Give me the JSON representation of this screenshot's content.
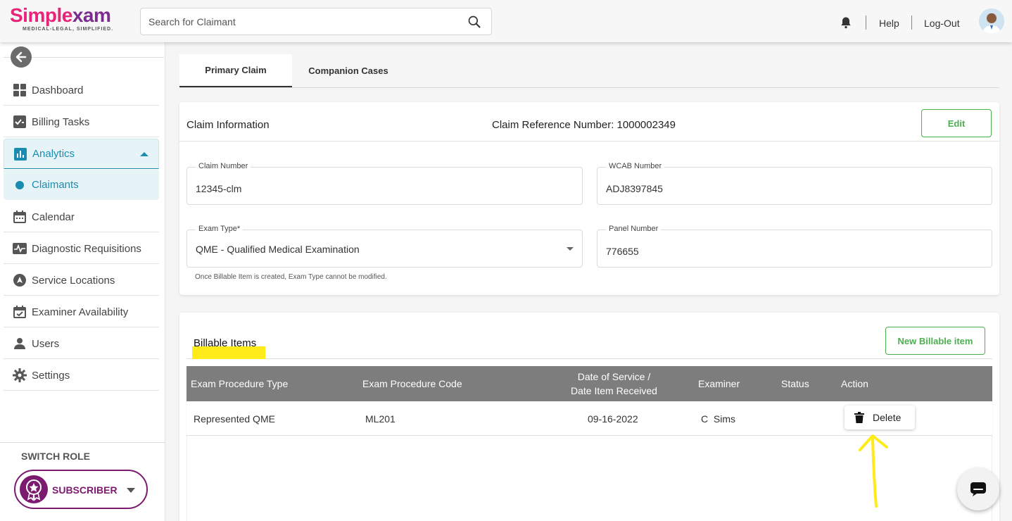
{
  "header": {
    "logo_text_1": "Simple",
    "logo_text_2": "xam",
    "logo_tagline": "MEDICAL-LEGAL, SIMPLIFIED.",
    "search_placeholder": "Search for Claimant",
    "help_label": "Help",
    "logout_label": "Log-Out"
  },
  "sidebar": {
    "items": [
      {
        "label": "Dashboard",
        "icon": "dashboard-icon"
      },
      {
        "label": "Billing Tasks",
        "icon": "billing-tasks-icon"
      },
      {
        "label": "Analytics",
        "icon": "analytics-icon",
        "active": true
      },
      {
        "label": "Claimants",
        "icon": "dot-icon",
        "sub": true
      },
      {
        "label": "Calendar",
        "icon": "calendar-icon"
      },
      {
        "label": "Diagnostic Requisitions",
        "icon": "pulse-icon"
      },
      {
        "label": "Service Locations",
        "icon": "location-icon"
      },
      {
        "label": "Examiner Availability",
        "icon": "calendar-check-icon"
      },
      {
        "label": "Users",
        "icon": "user-icon"
      },
      {
        "label": "Settings",
        "icon": "gear-icon"
      }
    ],
    "switch_role_title": "SWITCH ROLE",
    "role_label": "SUBSCRIBER"
  },
  "tabs": [
    {
      "label": "Primary Claim",
      "active": true
    },
    {
      "label": "Companion Cases",
      "active": false
    }
  ],
  "claim": {
    "title": "Claim Information",
    "reference": "Claim Reference Number: 1000002349",
    "edit_label": "Edit",
    "fields": {
      "claim_number_label": "Claim Number",
      "claim_number_value": "12345-clm",
      "wcab_label": "WCAB Number",
      "wcab_value": "ADJ8397845",
      "exam_type_label": "Exam Type*",
      "exam_type_value": "QME - Qualified Medical Examination",
      "panel_label": "Panel Number",
      "panel_value": "776655"
    },
    "helper_text": "Once Billable Item is created, Exam Type cannot be modified."
  },
  "billable": {
    "title": "Billable Items",
    "new_label": "New Billable item",
    "columns": {
      "type": "Exam Procedure Type",
      "code": "Exam Procedure Code",
      "date_line1": "Date of Service /",
      "date_line2": "Date Item Received",
      "examiner": "Examiner",
      "status": "Status",
      "action": "Action"
    },
    "rows": [
      {
        "type": "Represented QME",
        "code": "ML201",
        "date": "09-16-2022",
        "examiner": "C  Sims",
        "status": "",
        "action": "Delete"
      }
    ]
  },
  "colors": {
    "brand_pink": "#e5247a",
    "brand_purple": "#7b1a6e",
    "accent_blue": "#1a8cb0",
    "green": "#4caf50",
    "highlight_yellow": "#ffeb1a"
  }
}
